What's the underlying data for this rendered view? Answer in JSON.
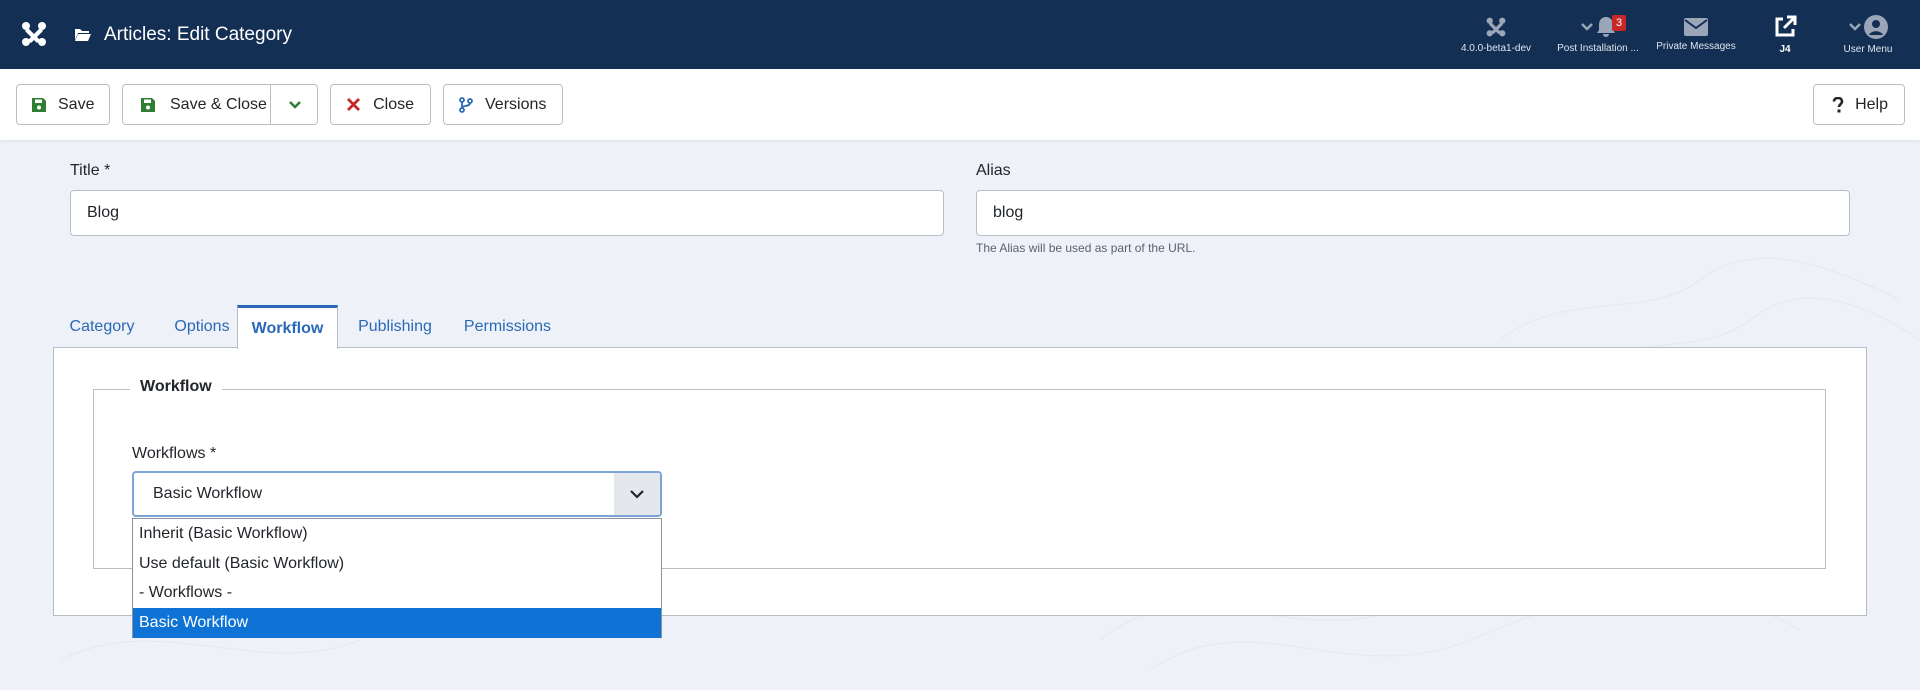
{
  "header": {
    "title": "Articles: Edit Category",
    "items": [
      {
        "label": "4.0.0-beta1-dev",
        "icon": "joomla-icon"
      },
      {
        "label": "Post Installation ...",
        "icon": "bell-icon",
        "badge": "3"
      },
      {
        "label": "Private Messages",
        "icon": "envelope-icon"
      },
      {
        "label": "J4",
        "icon": "external-link-icon"
      },
      {
        "label": "User Menu",
        "icon": "user-icon"
      }
    ]
  },
  "toolbar": {
    "save_label": "Save",
    "save_close_label": "Save & Close",
    "close_label": "Close",
    "versions_label": "Versions",
    "help_label": "Help"
  },
  "form": {
    "title_label": "Title *",
    "title_value": "Blog",
    "alias_label": "Alias",
    "alias_value": "blog",
    "alias_hint": "The Alias will be used as part of the URL."
  },
  "tabs": [
    "Category",
    "Options",
    "Workflow",
    "Publishing",
    "Permissions"
  ],
  "active_tab": "Workflow",
  "workflow": {
    "legend": "Workflow",
    "field_label": "Workflows *",
    "selected": "Basic Workflow",
    "options": [
      "Inherit (Basic Workflow)",
      "Use default (Basic Workflow)",
      "- Workflows -",
      "Basic Workflow"
    ]
  },
  "colors": {
    "header_bg": "#132f53",
    "accent": "#2a69b8",
    "save_green": "#2f7d32",
    "close_red": "#c52827",
    "option_selected": "#0f73d6"
  }
}
